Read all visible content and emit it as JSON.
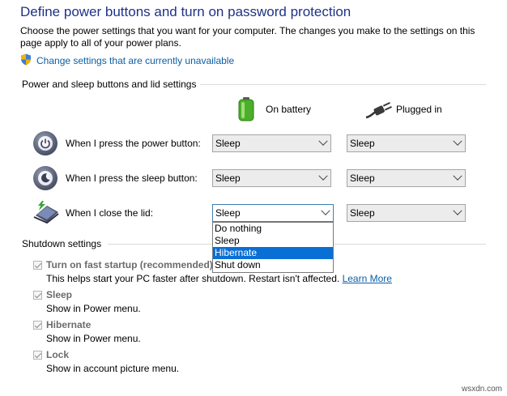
{
  "title": "Define power buttons and turn on password protection",
  "description": "Choose the power settings that you want for your computer. The changes you make to the settings on this page apply to all of your power plans.",
  "change_link": "Change settings that are currently unavailable",
  "power_section": {
    "label": "Power and sleep buttons and lid settings",
    "col_battery": "On battery",
    "col_plugged": "Plugged in",
    "rows": [
      {
        "label": "When I press the power button:",
        "battery": "Sleep",
        "plugged": "Sleep"
      },
      {
        "label": "When I press the sleep button:",
        "battery": "Sleep",
        "plugged": "Sleep"
      },
      {
        "label": "When I close the lid:",
        "battery": "Sleep",
        "plugged": "Sleep"
      }
    ]
  },
  "dropdown_options": [
    "Do nothing",
    "Sleep",
    "Hibernate",
    "Shut down"
  ],
  "dropdown_selected": "Hibernate",
  "shutdown_section": {
    "label": "Shutdown settings",
    "items": [
      {
        "label": "Turn on fast startup (recommended)",
        "desc": "This helps start your PC faster after shutdown. Restart isn't affected.",
        "link": "Learn More",
        "checked": true
      },
      {
        "label": "Sleep",
        "desc": "Show in Power menu.",
        "checked": true
      },
      {
        "label": "Hibernate",
        "desc": "Show in Power menu.",
        "checked": true
      },
      {
        "label": "Lock",
        "desc": "Show in account picture menu.",
        "checked": true
      }
    ]
  },
  "watermark": "wsxdn.com",
  "colors": {
    "title": "#1e3287",
    "link": "#0b5ea6",
    "selection": "#0a6fd4"
  }
}
